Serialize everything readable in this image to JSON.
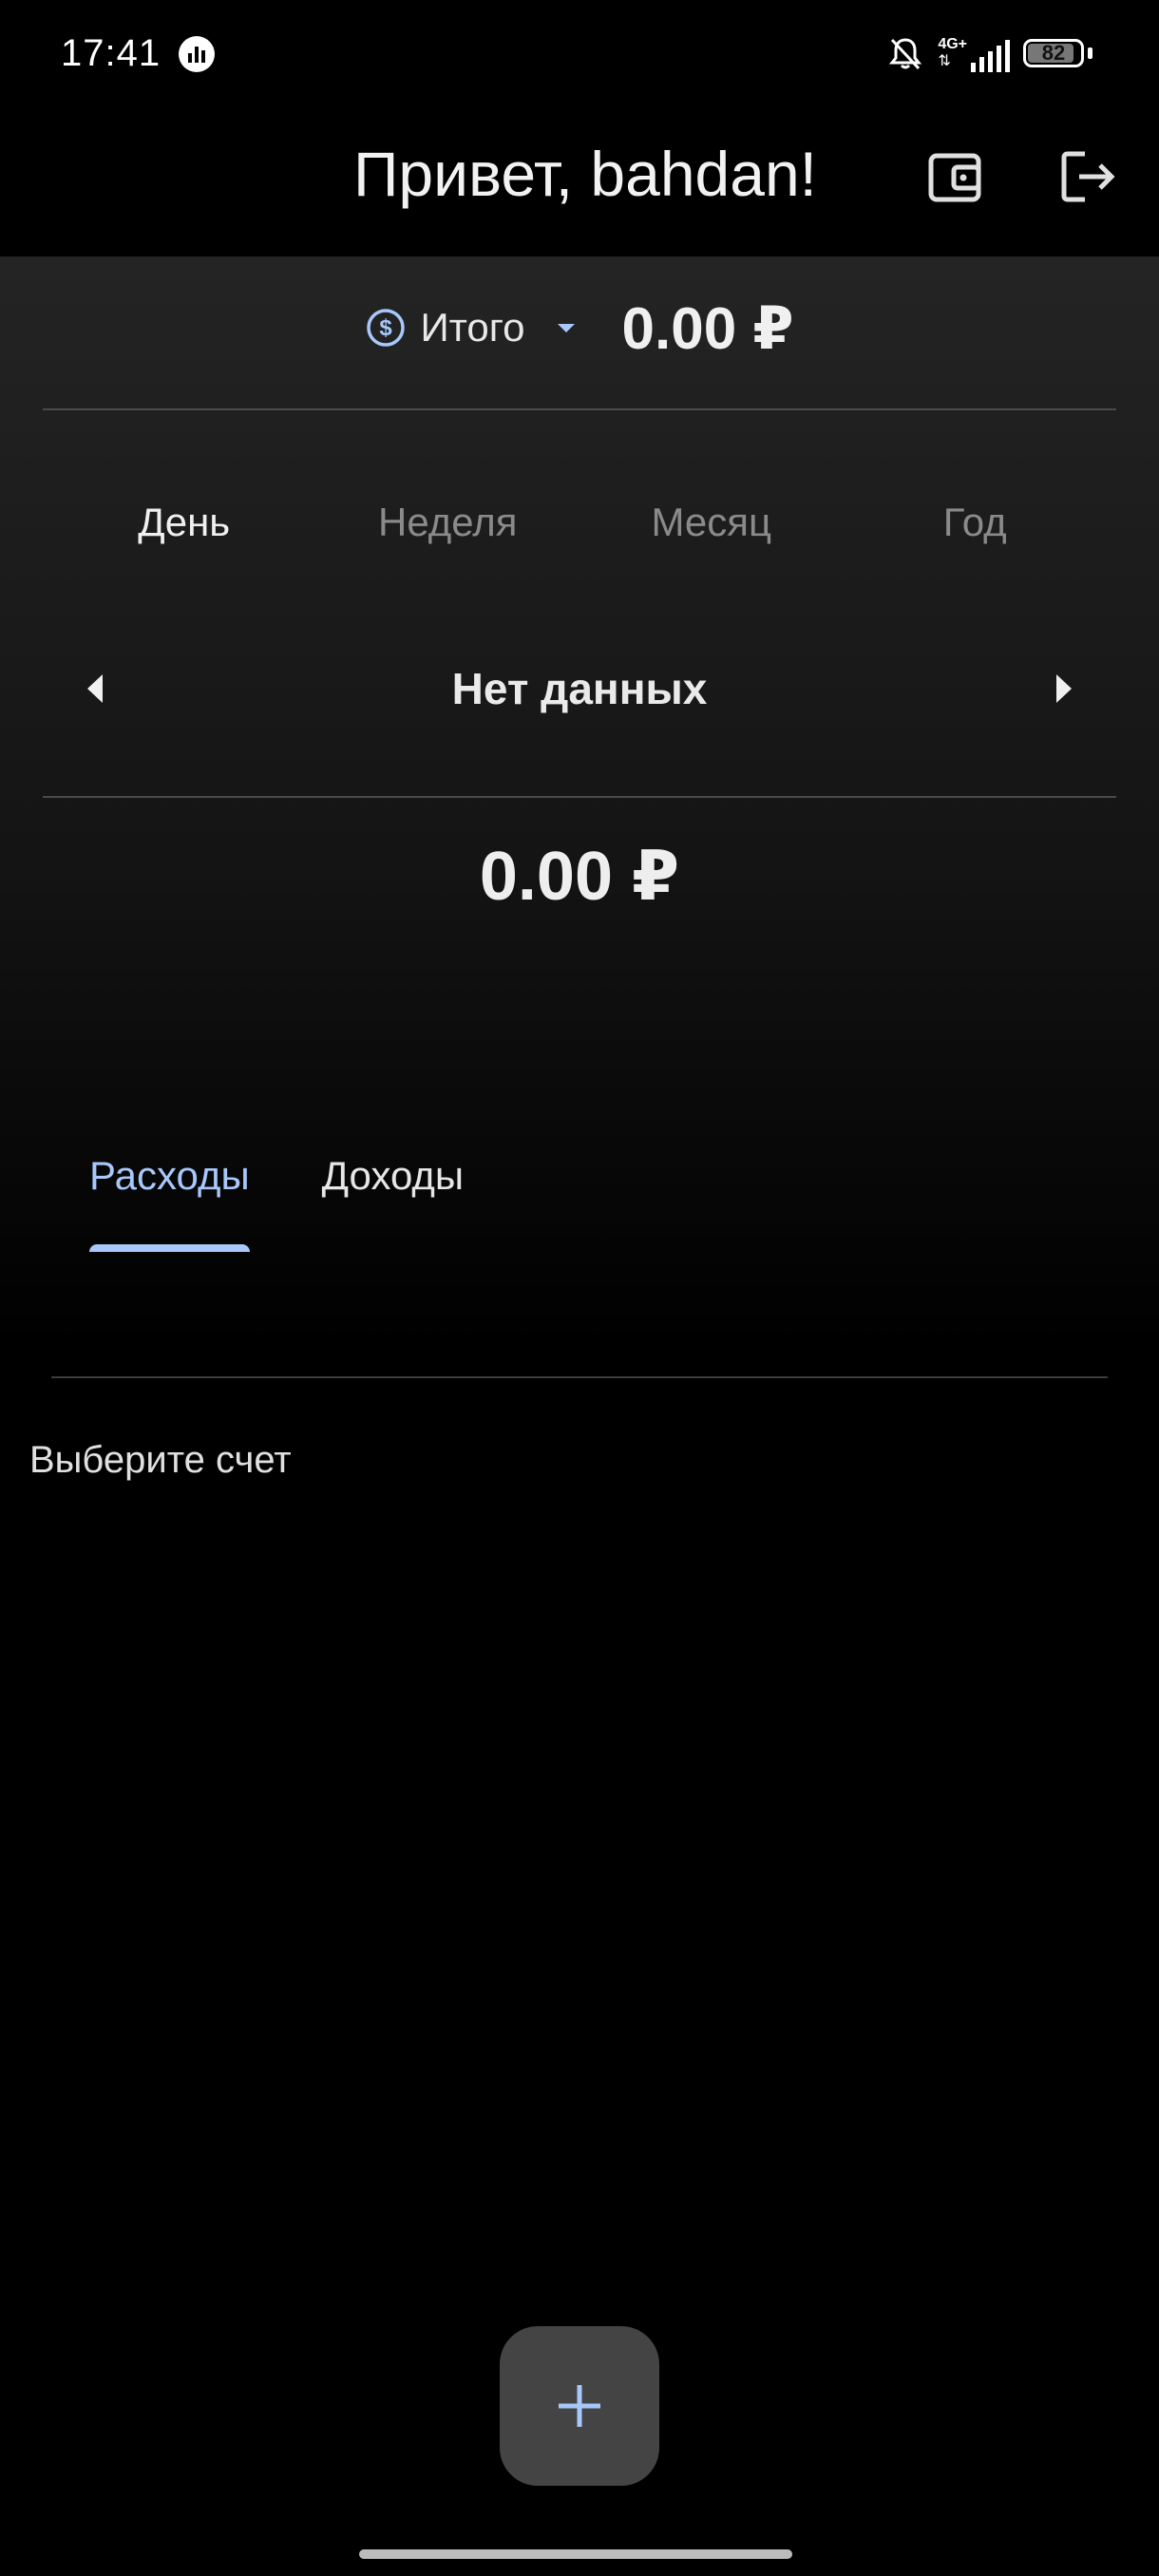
{
  "status_bar": {
    "time": "17:41",
    "network": "4G+",
    "battery": "82"
  },
  "app_bar": {
    "greeting": "Привет, bahdan!",
    "wallet_icon": "wallet-icon",
    "logout_icon": "logout-icon"
  },
  "summary": {
    "account_name": "Итого",
    "total_amount": "0.00 ₽"
  },
  "period_tabs": [
    {
      "label": "День",
      "active": true
    },
    {
      "label": "Неделя",
      "active": false
    },
    {
      "label": "Месяц",
      "active": false
    },
    {
      "label": "Год",
      "active": false
    }
  ],
  "period_nav": {
    "label": "Нет данных"
  },
  "period_amount": "0.00 ₽",
  "type_tabs": [
    {
      "label": "Расходы",
      "active": true
    },
    {
      "label": "Доходы",
      "active": false
    }
  ],
  "empty_message": "Выберите счет",
  "colors": {
    "accent": "#a8c7fa",
    "background": "#000000",
    "fab": "#444444"
  }
}
